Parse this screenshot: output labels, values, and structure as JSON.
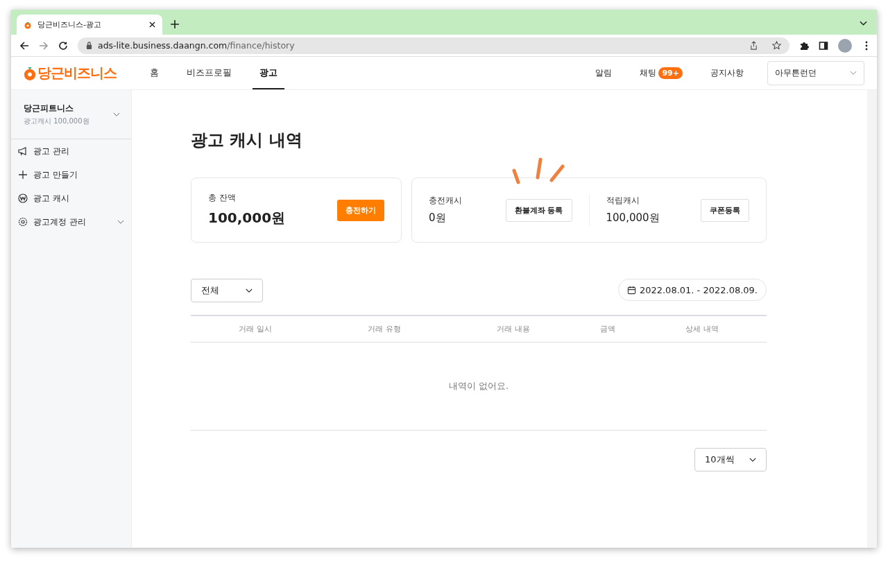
{
  "browser": {
    "tab_title": "당근비즈니스-광고",
    "url_host": "ads-lite.business.daangn.com",
    "url_path": "/finance/history"
  },
  "header": {
    "logo": "당근비즈니스",
    "nav": [
      {
        "label": "홈",
        "selected": false
      },
      {
        "label": "비즈프로필",
        "selected": false
      },
      {
        "label": "광고",
        "selected": true
      }
    ],
    "links": [
      {
        "label": "알림"
      },
      {
        "label": "채팅",
        "badge": "99+"
      },
      {
        "label": "공지사항"
      }
    ],
    "account": "아무튼런던"
  },
  "sidebar": {
    "business_name": "당근피트니스",
    "cash": "광고캐시 100,000원",
    "items": [
      {
        "kind": "megaphone",
        "label": "광고 관리",
        "expandable": false
      },
      {
        "kind": "plus",
        "label": "광고 만들기",
        "expandable": false
      },
      {
        "kind": "won",
        "label": "광고 캐시",
        "expandable": false
      },
      {
        "kind": "gear",
        "label": "광고계정 관리",
        "expandable": true
      }
    ]
  },
  "page_title": "광고 캐시 내역",
  "balance": {
    "label": "총 잔액",
    "amount": "100,000원",
    "button": "충전하기"
  },
  "cash_cards": [
    {
      "label": "충전캐시",
      "amount": "0원",
      "button": "환불계좌 등록"
    },
    {
      "label": "적립캐시",
      "amount": "100,000원",
      "button": "쿠폰등록"
    }
  ],
  "filter": {
    "value": "전체"
  },
  "date_range": "2022.08.01. - 2022.08.09.",
  "table": {
    "columns": [
      "거래 일시",
      "거래 유형",
      "거래 내용",
      "금액",
      "상세 내역"
    ],
    "empty_message": "내역이 없어요."
  },
  "page_size": "10개씩"
}
